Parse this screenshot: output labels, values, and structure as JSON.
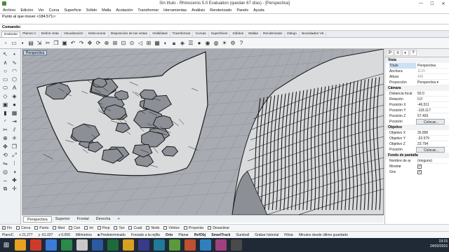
{
  "window": {
    "title": "Sin título - Rhinoceros 5.0 Evaluation (quedan 67 días) - [Perspectiva]",
    "min": "—",
    "max": "☐",
    "close": "✕"
  },
  "menu": [
    "Archivo",
    "Edición",
    "Ver",
    "Curva",
    "Superficie",
    "Sólido",
    "Malla",
    "Acotación",
    "Transformar",
    "Herramientas",
    "Análisis",
    "Renderizado",
    "Panels",
    "Ayuda"
  ],
  "command": {
    "history": "Punto al que mover <184.571>:",
    "prompt": "Comando:"
  },
  "toolbar_tabs": [
    "Estándar",
    "Planos C",
    "Definir vista",
    "Visualización",
    "Seleccionar",
    "Disposición de las vistas",
    "Visibilidad",
    "Transformar",
    "Curvas",
    "Superficies",
    "Sólidos",
    "Mallas",
    "Renderizado",
    "Dibujo",
    "Novedades V5"
  ],
  "viewport": {
    "label": "Perspectiva"
  },
  "viewport_tabs": [
    "Perspectiva",
    "Superior",
    "Frontal",
    "Derecha"
  ],
  "viewport_tabs_add": "+",
  "properties": {
    "vista_header": "Vista",
    "vista": [
      {
        "k": "Título",
        "v": "Perspectiva"
      },
      {
        "k": "Anchura",
        "v": "1129",
        "dim": true
      },
      {
        "k": "Altura",
        "v": "496",
        "dim": true
      },
      {
        "k": "Proyección",
        "v": "Perspectiva ▾"
      }
    ],
    "camara_header": "Cámara",
    "camara": [
      {
        "k": "Distancia focal",
        "v": "50.0"
      },
      {
        "k": "Rotación",
        "v": "0.0"
      },
      {
        "k": "Posición X",
        "v": "-46.511"
      },
      {
        "k": "Posición Y",
        "v": "-118.117"
      },
      {
        "k": "Posición Z",
        "v": "57.493"
      },
      {
        "k": "Posición",
        "v": "Colocar...",
        "btn": true
      }
    ],
    "objetivo_header": "Objetivo",
    "objetivo": [
      {
        "k": "Objetivo X",
        "v": "26.895"
      },
      {
        "k": "Objetivo Y",
        "v": "-32.579"
      },
      {
        "k": "Objetivo Z",
        "v": "23.794"
      },
      {
        "k": "Posición",
        "v": "Colocar...",
        "btn": true
      }
    ],
    "fondo_header": "Fondo de pantalla",
    "fondo": [
      {
        "k": "Nombre de ar",
        "v": "(ninguno)"
      },
      {
        "k": "Mostrar",
        "v": "✓",
        "chk": true
      },
      {
        "k": "Gris",
        "v": "✓",
        "chk": true
      }
    ]
  },
  "osnap": [
    {
      "label": "Fin",
      "checked": true
    },
    {
      "label": "Cerca",
      "checked": false
    },
    {
      "label": "Punto",
      "checked": false
    },
    {
      "label": "Med",
      "checked": false
    },
    {
      "label": "Cen",
      "checked": false
    },
    {
      "label": "Int",
      "checked": false
    },
    {
      "label": "Perp",
      "checked": false
    },
    {
      "label": "Tan",
      "checked": false
    },
    {
      "label": "Cuad",
      "checked": false
    },
    {
      "label": "Nodo",
      "checked": false
    },
    {
      "label": "Vértice",
      "checked": false
    },
    {
      "label": "Proyectar",
      "checked": false
    },
    {
      "label": "Desactivar",
      "checked": false
    }
  ],
  "status": [
    {
      "t": "PlanoC",
      "b": false
    },
    {
      "t": "x 21.277",
      "b": false
    },
    {
      "t": "y -61.027",
      "b": false
    },
    {
      "t": "z 0.000",
      "b": false
    },
    {
      "t": "Milímetros",
      "b": false
    },
    {
      "t": "■ Predeterminado",
      "b": false
    },
    {
      "t": "Forzado a la rejilla",
      "b": false
    },
    {
      "t": "Orto",
      "b": true
    },
    {
      "t": "Planar",
      "b": false
    },
    {
      "t": "RefObj",
      "b": true
    },
    {
      "t": "SmartTrack",
      "b": true
    },
    {
      "t": "Gumball",
      "b": false
    },
    {
      "t": "Grabar historial",
      "b": false
    },
    {
      "t": "Filtrar",
      "b": false
    },
    {
      "t": "Minutos desde último guardado",
      "b": false
    }
  ],
  "taskbar": {
    "time": "19:15",
    "date": "24/02/2016",
    "apps": [
      "#e8a020",
      "#d03a2a",
      "#3a7ad8",
      "#2a8a4a",
      "#c8c8c8",
      "#2a5aa0",
      "#1e6a3a",
      "#d8a020",
      "#3a3a8a",
      "#207a9a",
      "#5a9a3a",
      "#c05030",
      "#3080c0",
      "#a04080",
      "#4a4a4a"
    ]
  },
  "colors": {
    "viewport_bg": "#a8acb2",
    "grid": "#8e9298",
    "mesh_fill": "#d8dadc",
    "mesh_line": "#1a1a1a",
    "hole": "#8c9096"
  }
}
